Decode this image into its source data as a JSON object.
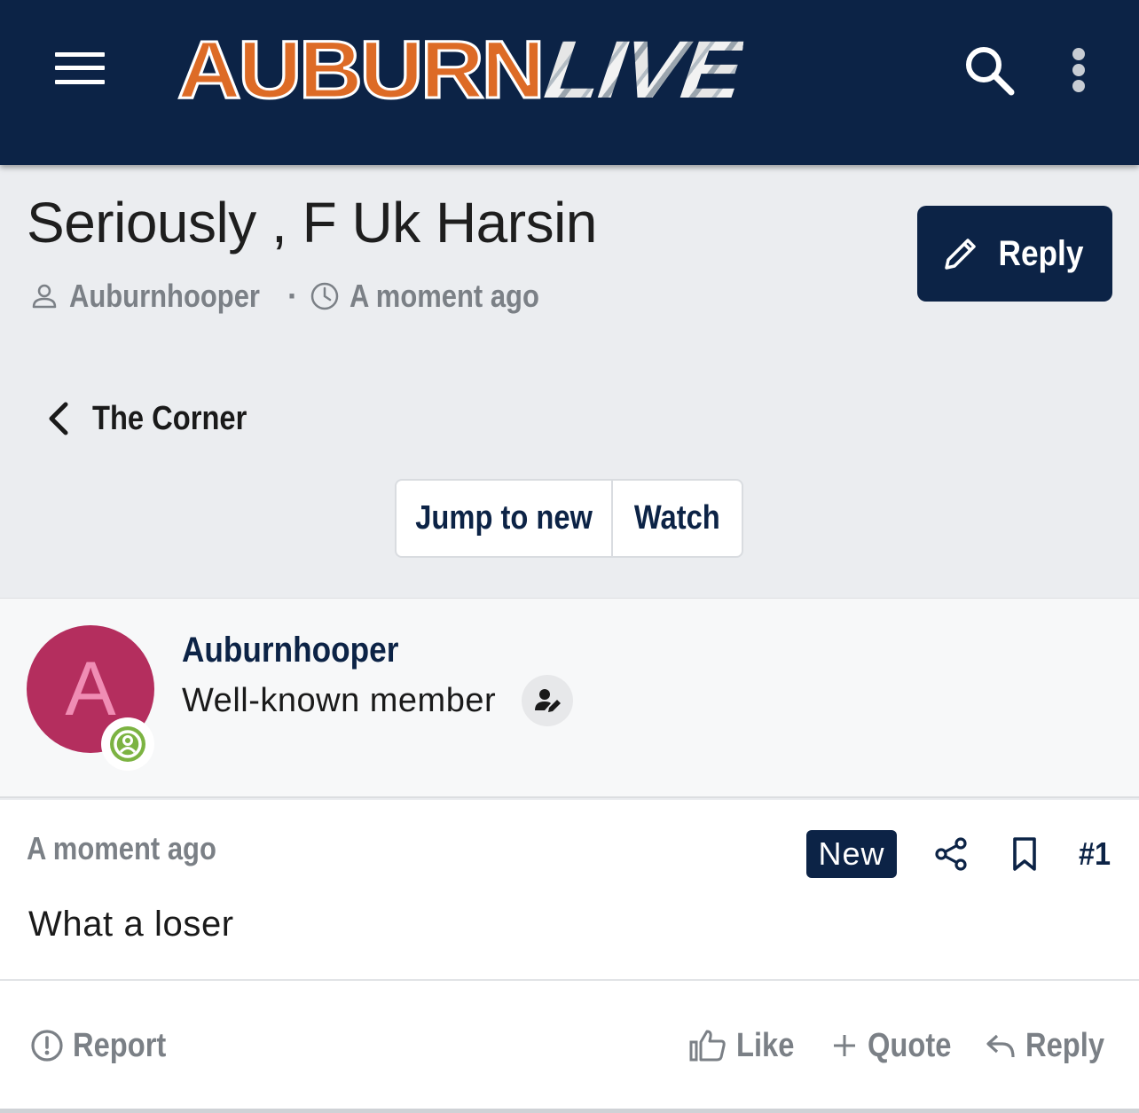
{
  "header": {
    "logo_primary": "AUBURN",
    "logo_secondary": "LIVE",
    "icons": [
      "hamburger-menu-icon",
      "search-icon",
      "more-vertical-icon"
    ],
    "colors": {
      "navy": "#0c2346",
      "orange": "#dd6b26"
    }
  },
  "thread": {
    "title": "Seriously , F Uk Harsin",
    "author": "Auburnhooper",
    "separator": "·",
    "posted": "A moment ago",
    "reply_label": "Reply"
  },
  "breadcrumb": {
    "label": "The Corner"
  },
  "actions_bar": {
    "jump_label": "Jump to new",
    "watch_label": "Watch"
  },
  "post_author": {
    "avatar_letter": "A",
    "avatar_color": "#b42e5e",
    "username": "Auburnhooper",
    "title": "Well-known member"
  },
  "post": {
    "time": "A moment ago",
    "new_badge": "New",
    "number": "#1",
    "body": "What a loser",
    "report_label": "Report",
    "like_label": "Like",
    "quote_label": "Quote",
    "reply_label": "Reply"
  }
}
